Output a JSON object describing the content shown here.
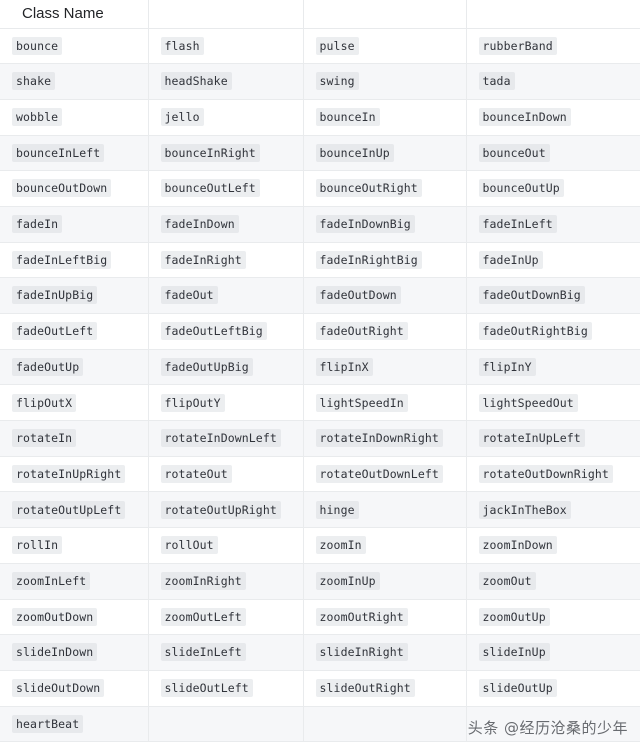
{
  "table": {
    "headers": [
      "Class Name",
      "",
      "",
      ""
    ],
    "rows": [
      [
        "bounce",
        "flash",
        "pulse",
        "rubberBand"
      ],
      [
        "shake",
        "headShake",
        "swing",
        "tada"
      ],
      [
        "wobble",
        "jello",
        "bounceIn",
        "bounceInDown"
      ],
      [
        "bounceInLeft",
        "bounceInRight",
        "bounceInUp",
        "bounceOut"
      ],
      [
        "bounceOutDown",
        "bounceOutLeft",
        "bounceOutRight",
        "bounceOutUp"
      ],
      [
        "fadeIn",
        "fadeInDown",
        "fadeInDownBig",
        "fadeInLeft"
      ],
      [
        "fadeInLeftBig",
        "fadeInRight",
        "fadeInRightBig",
        "fadeInUp"
      ],
      [
        "fadeInUpBig",
        "fadeOut",
        "fadeOutDown",
        "fadeOutDownBig"
      ],
      [
        "fadeOutLeft",
        "fadeOutLeftBig",
        "fadeOutRight",
        "fadeOutRightBig"
      ],
      [
        "fadeOutUp",
        "fadeOutUpBig",
        "flipInX",
        "flipInY"
      ],
      [
        "flipOutX",
        "flipOutY",
        "lightSpeedIn",
        "lightSpeedOut"
      ],
      [
        "rotateIn",
        "rotateInDownLeft",
        "rotateInDownRight",
        "rotateInUpLeft"
      ],
      [
        "rotateInUpRight",
        "rotateOut",
        "rotateOutDownLeft",
        "rotateOutDownRight"
      ],
      [
        "rotateOutUpLeft",
        "rotateOutUpRight",
        "hinge",
        "jackInTheBox"
      ],
      [
        "rollIn",
        "rollOut",
        "zoomIn",
        "zoomInDown"
      ],
      [
        "zoomInLeft",
        "zoomInRight",
        "zoomInUp",
        "zoomOut"
      ],
      [
        "zoomOutDown",
        "zoomOutLeft",
        "zoomOutRight",
        "zoomOutUp"
      ],
      [
        "slideInDown",
        "slideInLeft",
        "slideInRight",
        "slideInUp"
      ],
      [
        "slideOutDown",
        "slideOutLeft",
        "slideOutRight",
        "slideOutUp"
      ],
      [
        "heartBeat",
        "",
        "",
        ""
      ]
    ]
  },
  "watermark": {
    "text": "头条 @经历沧桑的少年"
  },
  "colors": {
    "code_background": "#eceef0",
    "stripe_background": "#f6f7f9",
    "border": "#e9ebed",
    "text": "#30333a"
  }
}
